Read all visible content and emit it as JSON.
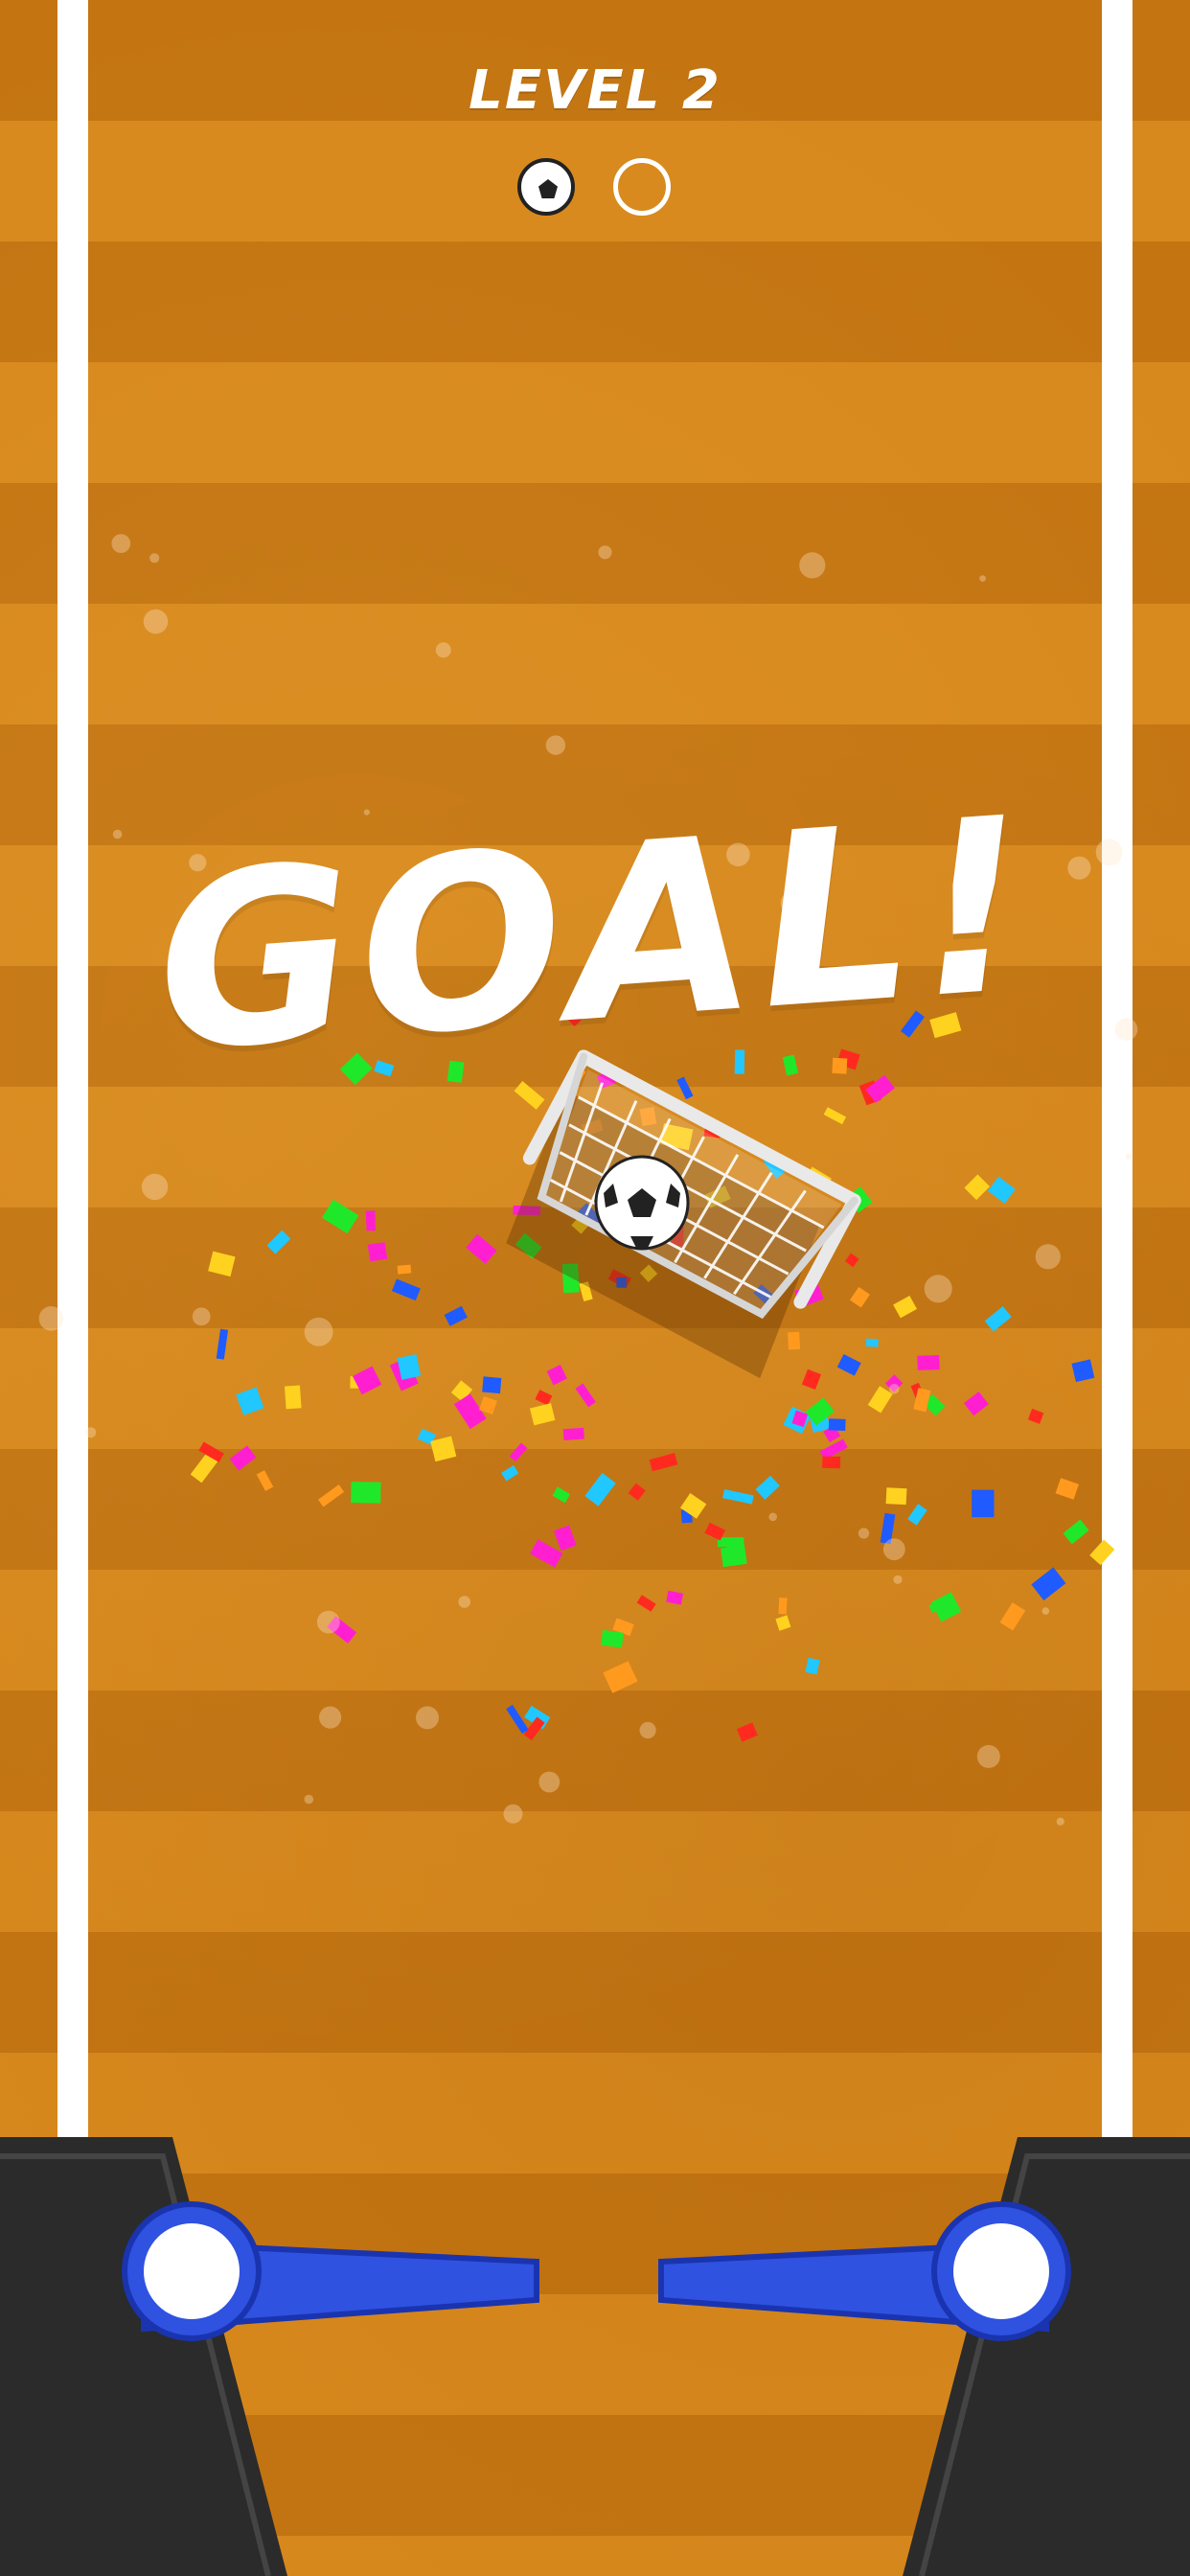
{
  "hud": {
    "level_label": "LEVEL 2",
    "balls": [
      {
        "state": "scored",
        "icon": "soccer-ball-icon"
      },
      {
        "state": "remaining",
        "icon": "empty-ball-slot-icon"
      }
    ]
  },
  "message": {
    "goal_text": "GOAL!"
  },
  "colors": {
    "field_dark": "#c47512",
    "field_light": "#d8891d",
    "line": "#ffffff",
    "flipper": "#2f52e0",
    "flipper_edge": "#1a34b0",
    "bumper": "#2b2b2b"
  },
  "icons": {
    "goal": "goal-net-icon",
    "ball": "soccer-ball-icon",
    "left_flipper": "left-flipper-icon",
    "right_flipper": "right-flipper-icon"
  }
}
